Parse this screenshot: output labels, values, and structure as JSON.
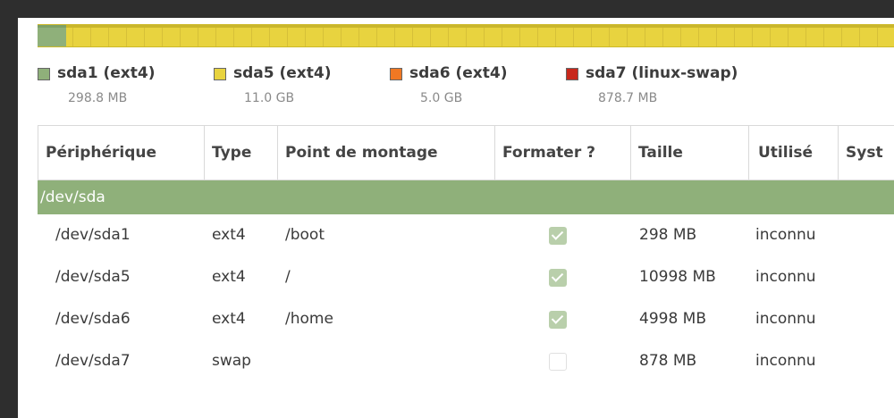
{
  "colors": {
    "sda1": "#8fb07a",
    "sda5": "#e8d33f",
    "sda6": "#f07823",
    "sda7": "#c8281c",
    "device_row": "#8fb07a"
  },
  "legend": [
    {
      "name": "sda1 (ext4)",
      "size": "298.8 MB"
    },
    {
      "name": "sda5 (ext4)",
      "size": "11.0 GB"
    },
    {
      "name": "sda6 (ext4)",
      "size": "5.0 GB"
    },
    {
      "name": "sda7 (linux-swap)",
      "size": "878.7 MB"
    }
  ],
  "table": {
    "headers": [
      "Périphérique",
      "Type",
      "Point de montage",
      "Formater ?",
      "Taille",
      "Utilisé",
      "Syst"
    ],
    "device": "/dev/sda",
    "rows": [
      {
        "device": "/dev/sda1",
        "type": "ext4",
        "mount": "/boot",
        "format": true,
        "size": "298 MB",
        "used": "inconnu"
      },
      {
        "device": "/dev/sda5",
        "type": "ext4",
        "mount": "/",
        "format": true,
        "size": "10998 MB",
        "used": "inconnu"
      },
      {
        "device": "/dev/sda6",
        "type": "ext4",
        "mount": "/home",
        "format": true,
        "size": "4998 MB",
        "used": "inconnu"
      },
      {
        "device": "/dev/sda7",
        "type": "swap",
        "mount": "",
        "format": false,
        "size": "878 MB",
        "used": "inconnu"
      }
    ]
  }
}
